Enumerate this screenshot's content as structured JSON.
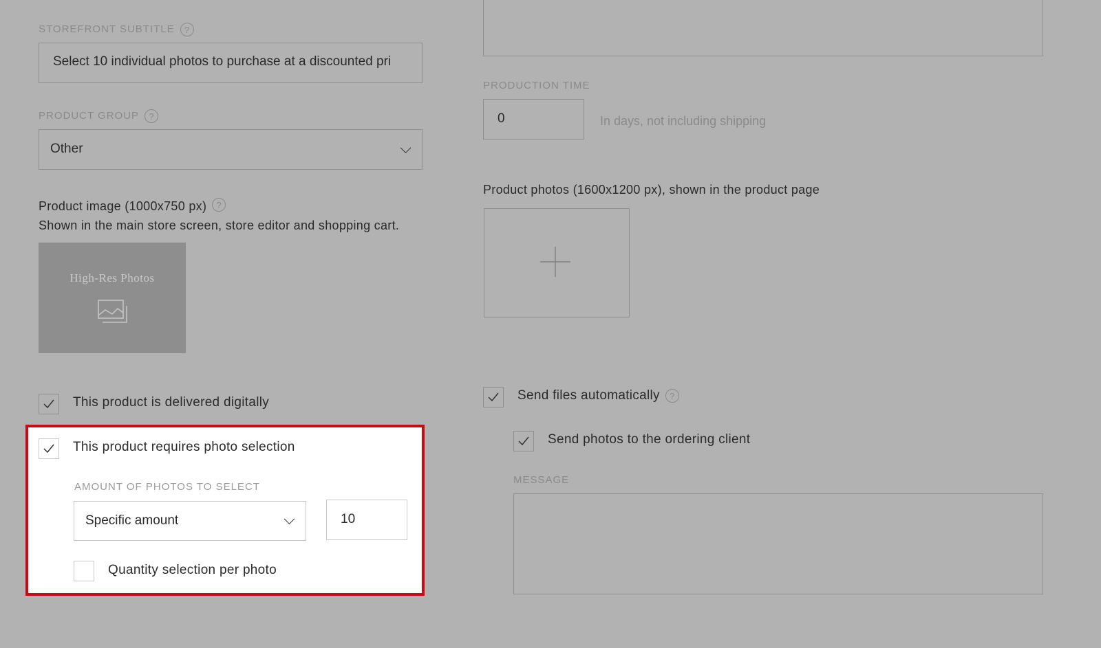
{
  "storefront_subtitle": {
    "label": "STOREFRONT SUBTITLE",
    "value": "Select 10 individual photos to purchase at a discounted pri"
  },
  "product_group": {
    "label": "PRODUCT GROUP",
    "selected": "Other"
  },
  "product_image": {
    "title": "Product image (1000x750 px)",
    "description": "Shown in the main store screen, store editor and shopping cart.",
    "thumbnail_text": "High-Res Photos"
  },
  "delivered_digitally": {
    "label": "This product is delivered digitally",
    "checked": true
  },
  "photo_selection": {
    "label": "This product requires photo selection",
    "checked": true,
    "amount_label": "AMOUNT OF PHOTOS TO SELECT",
    "amount_mode": "Specific amount",
    "amount_value": "10",
    "quantity_label": "Quantity selection per photo",
    "quantity_checked": false
  },
  "production_time": {
    "label": "PRODUCTION TIME",
    "value": "0",
    "hint": "In days, not including shipping"
  },
  "product_photos": {
    "title": "Product photos (1600x1200 px), shown in the product page"
  },
  "send_files": {
    "label": "Send files automatically",
    "checked": true
  },
  "send_photos": {
    "label": "Send photos to the ordering client",
    "checked": true
  },
  "message": {
    "label": "MESSAGE",
    "value": ""
  },
  "colors": {
    "overlay": "#b2b2b2",
    "highlight_border": "#cc0a14"
  }
}
